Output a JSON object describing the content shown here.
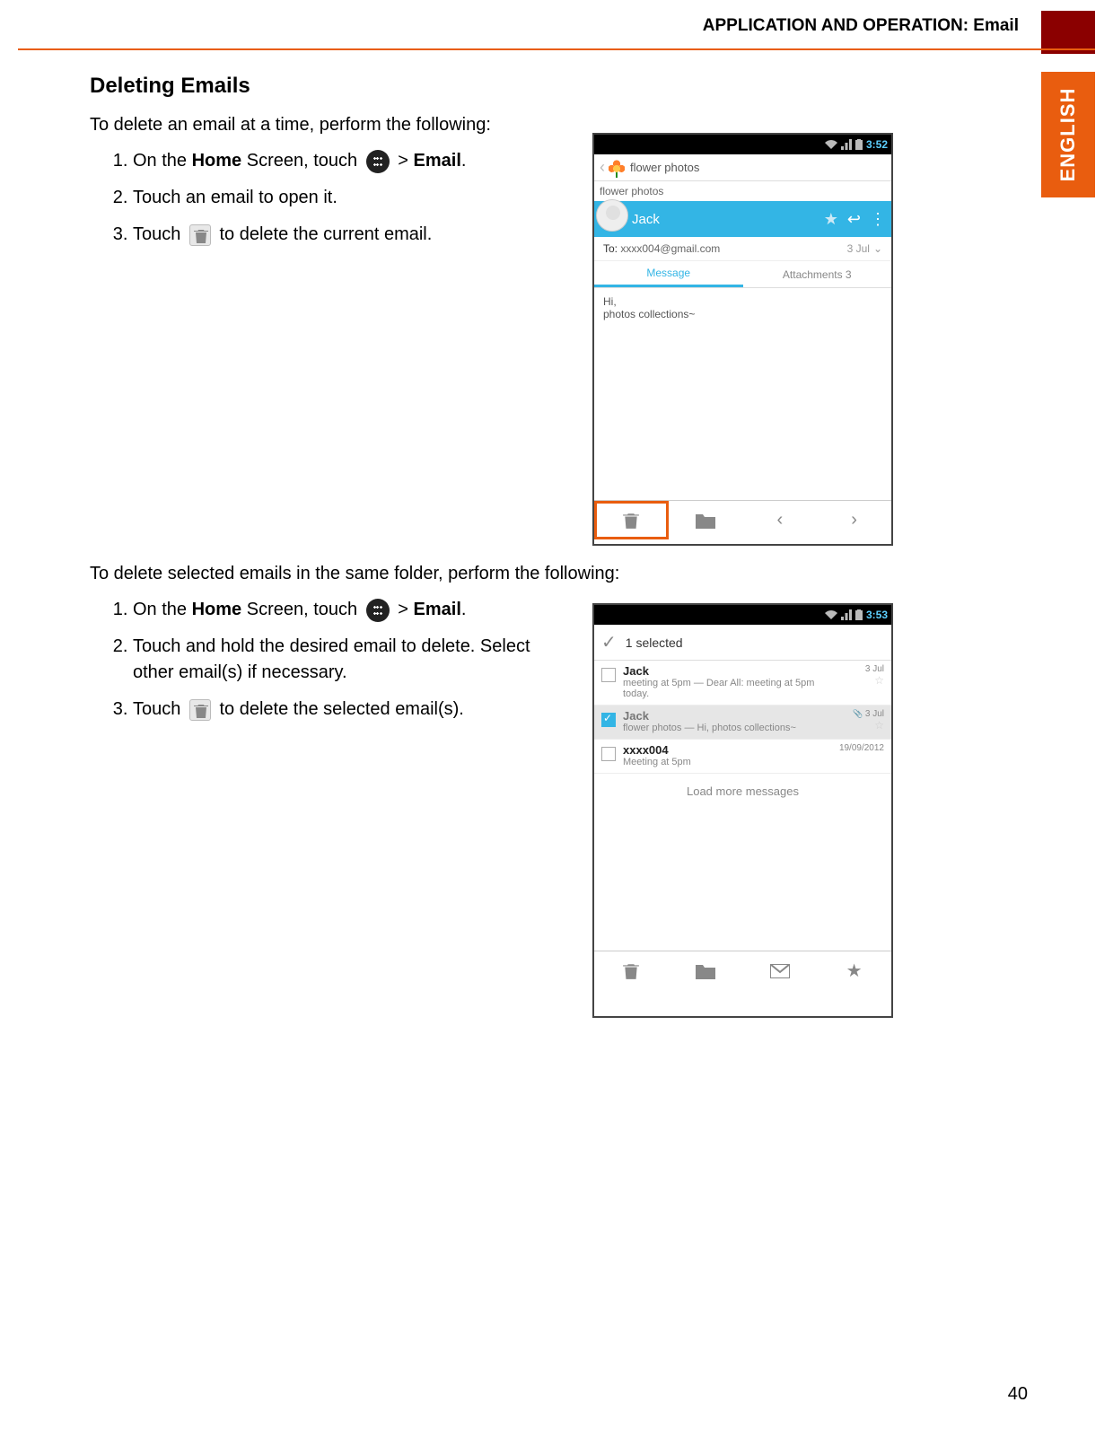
{
  "header": {
    "title": "APPLICATION AND OPERATION: Email",
    "language_tab": "ENGLISH"
  },
  "page_number": "40",
  "section_title": "Deleting Emails",
  "para1": "To delete an email at a time, perform the following:",
  "steps1": {
    "s1_pre": "On the ",
    "s1_home": "Home",
    "s1_mid": " Screen, touch ",
    "s1_gt": " > ",
    "s1_email": "Email",
    "s1_end": ".",
    "s2": "Touch an email to open it.",
    "s3_pre": "Touch ",
    "s3_end": " to delete the current email."
  },
  "para2": "To delete selected emails in the same folder, perform the following:",
  "steps2": {
    "s1_pre": "On the ",
    "s1_home": "Home",
    "s1_mid": " Screen, touch ",
    "s1_gt": "  > ",
    "s1_email": "Email",
    "s1_end": ".",
    "s2": "Touch and hold the desired email to delete. Select other email(s) if necessary.",
    "s3_pre": "Touch ",
    "s3_end": " to delete the selected email(s)."
  },
  "shot1": {
    "time": "3:52",
    "folder_title": "flower photos",
    "subject_label": "flower photos",
    "sender": "Jack",
    "to_label": "To:",
    "to_addr": "xxxx004@gmail.com",
    "date": "3 Jul",
    "tab_message": "Message",
    "tab_attachments": "Attachments 3",
    "body_line1": "Hi,",
    "body_line2": "photos collections~"
  },
  "shot2": {
    "time": "3:53",
    "selected_text": "1 selected",
    "items": [
      {
        "sender": "Jack",
        "sub": "meeting at 5pm — Dear All: meeting at 5pm today.",
        "date": "3 Jul",
        "checked": false
      },
      {
        "sender": "Jack",
        "sub": "flower photos — Hi, photos collections~",
        "date": "3 Jul",
        "checked": true
      },
      {
        "sender": "xxxx004",
        "sub": "Meeting at 5pm",
        "date": "19/09/2012",
        "checked": false
      }
    ],
    "load_more": "Load more messages"
  }
}
